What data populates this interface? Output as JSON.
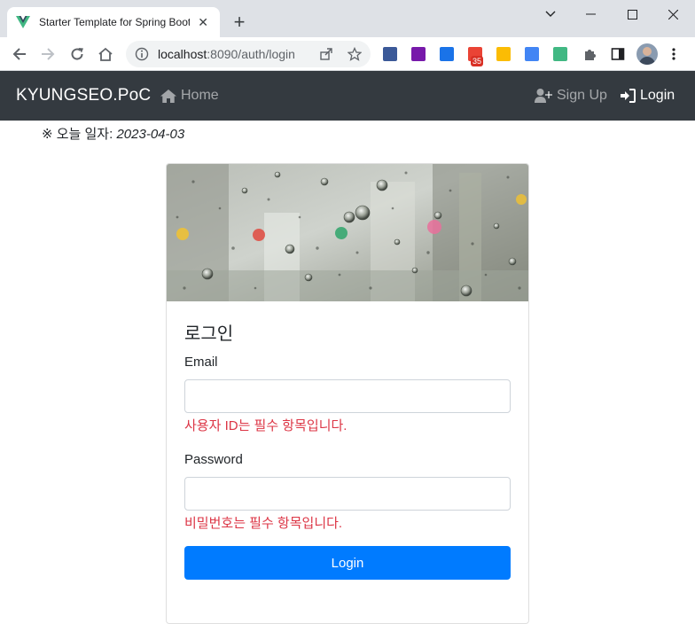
{
  "browser": {
    "tab_title": "Starter Template for Spring Boot",
    "url_host": "localhost",
    "url_rest": ":8090/auth/login",
    "extensions": [
      {
        "name": "download-ext-icon",
        "color": "#3b5998"
      },
      {
        "name": "onenote-ext-icon",
        "color": "#7719aa"
      },
      {
        "name": "s-ext-icon",
        "color": "#1a73e8"
      },
      {
        "name": "gmail-ext-icon",
        "color": "#ea4335",
        "badge": "35"
      },
      {
        "name": "keep-ext-icon",
        "color": "#fbbc04"
      },
      {
        "name": "translate-ext-icon",
        "color": "#4285f4"
      },
      {
        "name": "vue-ext-icon",
        "color": "#41b883"
      }
    ],
    "accent": "#dee1e6"
  },
  "navbar": {
    "brand": "KYUNGSEO.PoC",
    "home": "Home",
    "signup": "Sign Up",
    "login": "Login",
    "bg": "#343a40"
  },
  "page": {
    "today_label": "※ 오늘 일자: ",
    "today_value": "2023-04-03"
  },
  "form": {
    "title": "로그인",
    "email_label": "Email",
    "email_value": "",
    "email_error": "사용자 ID는 필수 항목입니다.",
    "password_label": "Password",
    "password_value": "",
    "password_error": "비밀번호는 필수 항목입니다.",
    "submit": "Login",
    "accent": "#007bff",
    "error_color": "#dc3545"
  }
}
